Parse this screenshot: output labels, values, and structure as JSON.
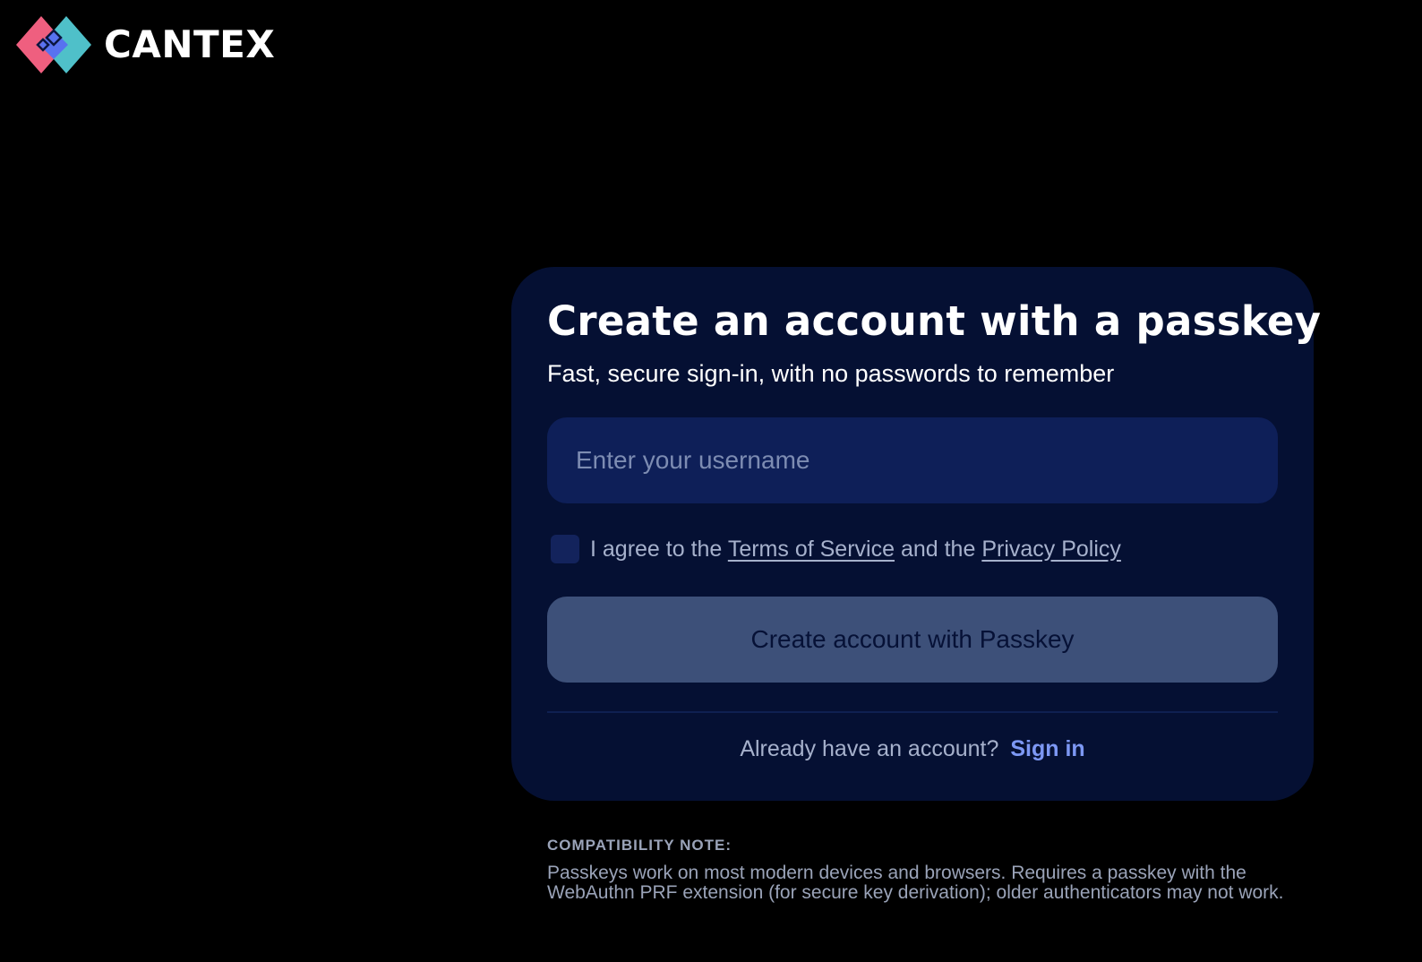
{
  "brand": {
    "name": "CANTEX",
    "colors": {
      "pink": "#ef5f7f",
      "teal": "#4fc0c9",
      "blue": "#5872f0",
      "navy": "#0b1640"
    }
  },
  "card": {
    "title": "Create an account with a passkey",
    "subtitle": "Fast, secure sign-in, with no passwords to remember",
    "username": {
      "value": "",
      "placeholder": "Enter your username"
    },
    "agreement": {
      "checked": false,
      "prefix": "I agree to the",
      "terms_label": "Terms of Service",
      "middle": "and the",
      "privacy_label": "Privacy Policy"
    },
    "create_button_label": "Create account with Passkey",
    "signin": {
      "prompt": "Already have an account?",
      "link_label": "Sign in"
    }
  },
  "compatibility": {
    "heading": "COMPATIBILITY NOTE:",
    "body": "Passkeys work on most modern devices and browsers. Requires a passkey with the WebAuthn PRF extension (for secure key derivation); older authenticators may not work."
  },
  "theme": {
    "background": "#000000",
    "card": "#051033",
    "input": "#0e1f58",
    "button": "#3d5079",
    "link": "#7d98f4"
  }
}
